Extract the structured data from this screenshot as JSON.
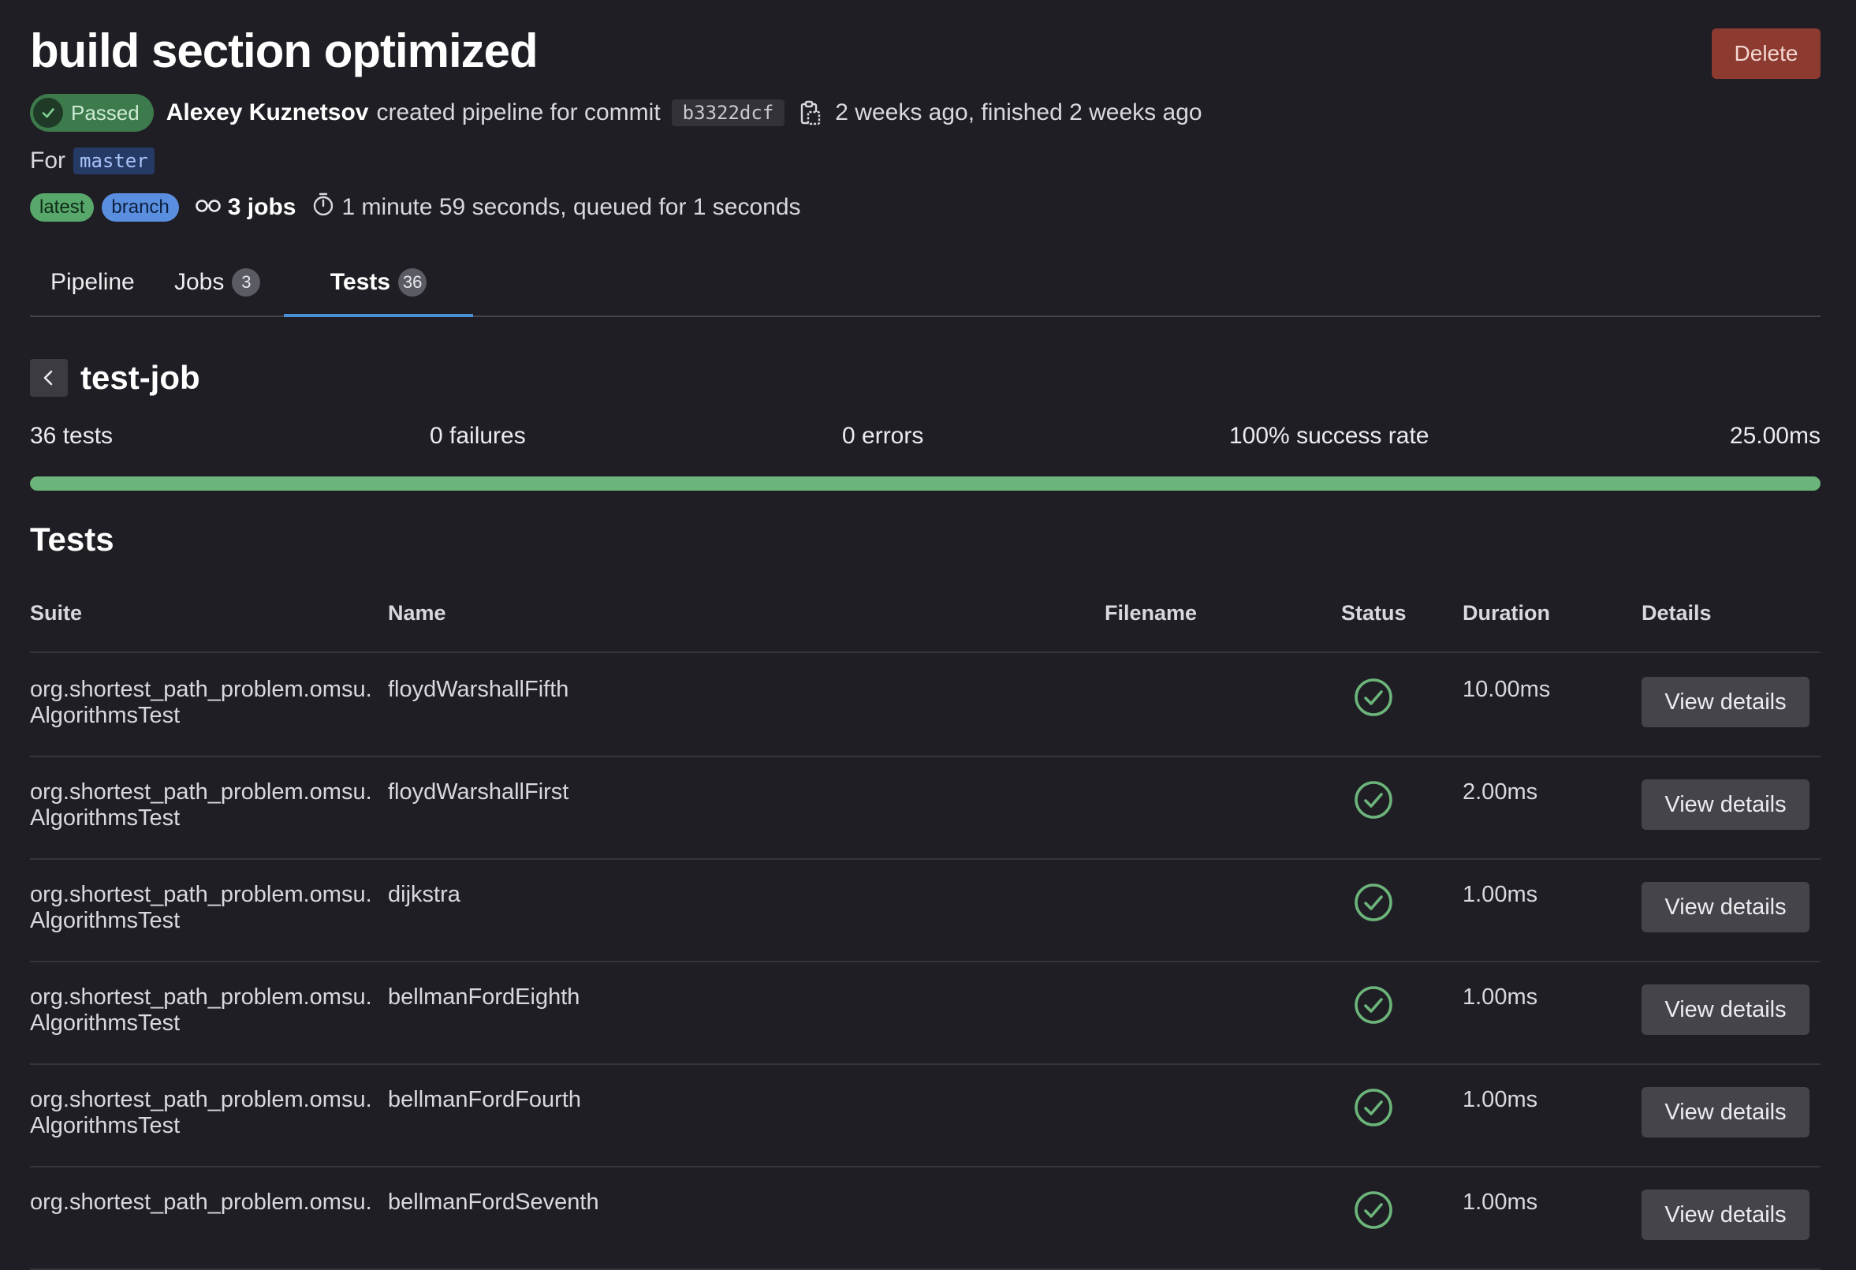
{
  "header": {
    "title": "build section optimized",
    "delete_label": "Delete",
    "status_badge": "Passed",
    "author": "Alexey Kuznetsov",
    "created_text": "created pipeline for commit",
    "commit_sha": "b3322dcf",
    "time_text": "2 weeks ago, finished 2 weeks ago",
    "for_label": "For",
    "ref": "master",
    "badge_latest": "latest",
    "badge_branch": "branch",
    "jobs_count": "3 jobs",
    "duration_text": "1 minute 59 seconds, queued for 1 seconds"
  },
  "tabs": [
    {
      "label": "Pipeline",
      "count": ""
    },
    {
      "label": "Jobs",
      "count": "3"
    },
    {
      "label": "Tests",
      "count": "36",
      "active": true
    }
  ],
  "job": {
    "name": "test-job",
    "summary": {
      "tests": "36 tests",
      "failures": "0 failures",
      "errors": "0 errors",
      "success_rate": "100% success rate",
      "duration": "25.00ms"
    },
    "success_fraction": 1.0
  },
  "tests_section": {
    "title": "Tests",
    "columns": {
      "suite": "Suite",
      "name": "Name",
      "filename": "Filename",
      "status": "Status",
      "duration": "Duration",
      "details": "Details"
    },
    "rows": [
      {
        "suite": "org.shortest_path_problem.omsu.\nAlgorithmsTest",
        "name": "floydWarshallFifth",
        "duration": "10.00ms",
        "details_label": "View details"
      },
      {
        "suite": "org.shortest_path_problem.omsu.\nAlgorithmsTest",
        "name": "floydWarshallFirst",
        "duration": "2.00ms",
        "details_label": "View details"
      },
      {
        "suite": "org.shortest_path_problem.omsu.\nAlgorithmsTest",
        "name": "dijkstra",
        "duration": "1.00ms",
        "details_label": "View details"
      },
      {
        "suite": "org.shortest_path_problem.omsu.\nAlgorithmsTest",
        "name": "bellmanFordEighth",
        "duration": "1.00ms",
        "details_label": "View details"
      },
      {
        "suite": "org.shortest_path_problem.omsu.\nAlgorithmsTest",
        "name": "bellmanFordFourth",
        "duration": "1.00ms",
        "details_label": "View details"
      },
      {
        "suite": "org.shortest_path_problem.omsu.",
        "name": "bellmanFordSeventh",
        "duration": "1.00ms",
        "details_label": "View details"
      }
    ]
  },
  "colors": {
    "background": "#1f1e24",
    "success": "#6cb57a",
    "danger": "#8d3a30",
    "tab_active": "#4a90d9"
  }
}
